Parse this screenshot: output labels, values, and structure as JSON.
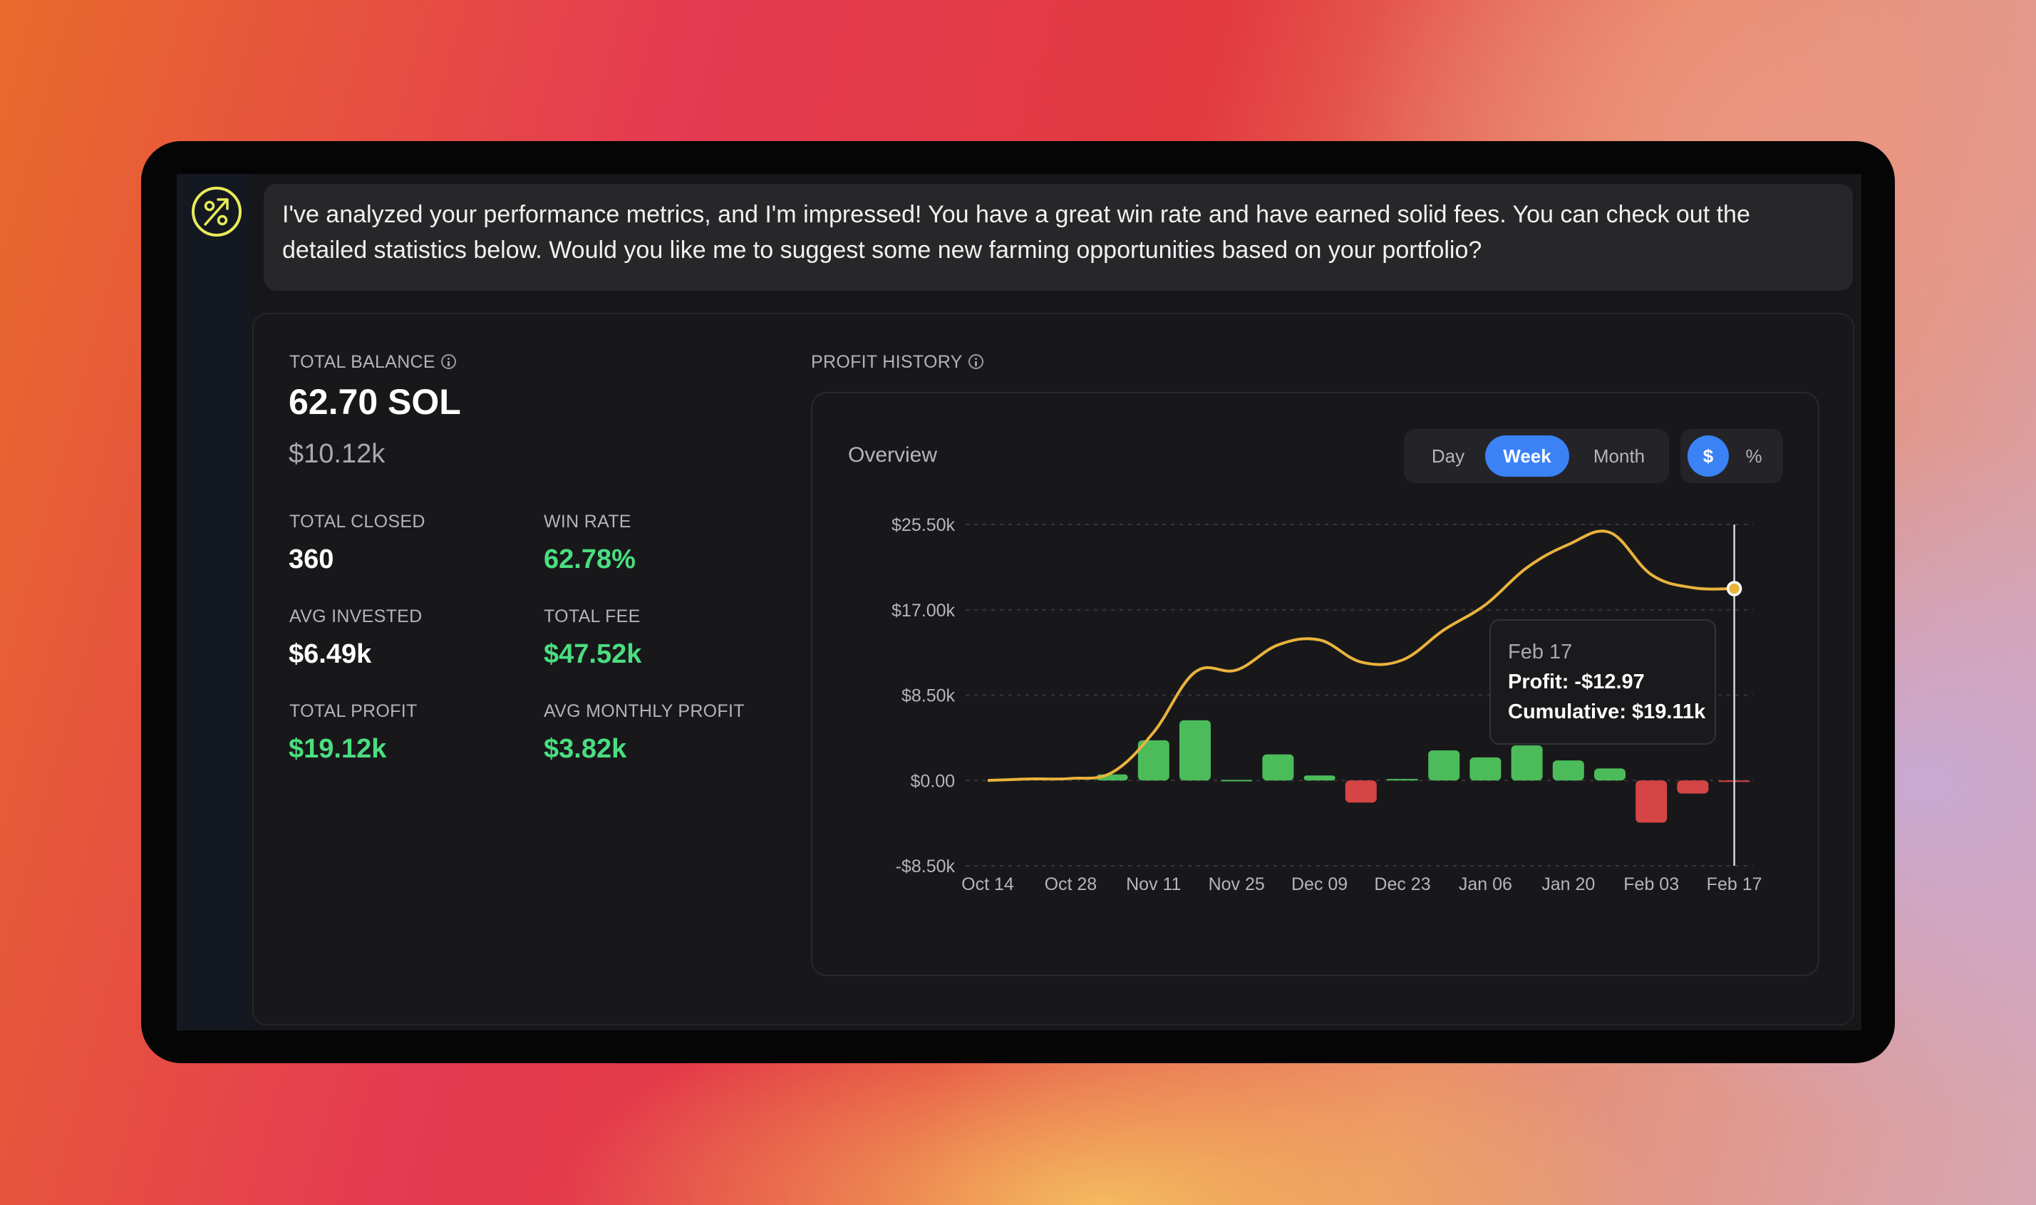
{
  "message": {
    "line1": "I've analyzed your performance metrics, and I'm impressed! You have a great win rate and have earned solid fees. You can check out the",
    "line2": "detailed statistics below. Would you like me to suggest some new farming opportunities based on your portfolio?"
  },
  "stats": {
    "total_balance_label": "TOTAL BALANCE",
    "total_balance_sol": "62.70 SOL",
    "total_balance_usd": "$10.12k",
    "total_closed_label": "TOTAL CLOSED",
    "total_closed": "360",
    "win_rate_label": "WIN RATE",
    "win_rate": "62.78%",
    "avg_invested_label": "AVG INVESTED",
    "avg_invested": "$6.49k",
    "total_fee_label": "TOTAL FEE",
    "total_fee": "$47.52k",
    "total_profit_label": "TOTAL PROFIT",
    "total_profit": "$19.12k",
    "avg_monthly_profit_label": "AVG MONTHLY PROFIT",
    "avg_monthly_profit": "$3.82k"
  },
  "profit_history": {
    "label": "PROFIT HISTORY",
    "overview": "Overview",
    "timeframes": [
      "Day",
      "Week",
      "Month"
    ],
    "selected_timeframe": "Week",
    "units": [
      "$",
      "%"
    ],
    "selected_unit": "$"
  },
  "tooltip": {
    "date": "Feb 17",
    "profit": "Profit: -$12.97",
    "cumulative": "Cumulative: $19.11k"
  },
  "colors": {
    "positive": "#4ade80",
    "negative": "#ef4444",
    "line": "#eab33c",
    "accent": "#3b82f6",
    "bar_positive": "#4cbc5a",
    "bar_negative": "#d64545"
  },
  "chart_data": {
    "type": "bar",
    "y_ticks": [
      25500,
      17000,
      8500,
      0,
      -8500
    ],
    "y_tick_labels": [
      "$25.50k",
      "$17.00k",
      "$8.50k",
      "$0.00",
      "-$8.50k"
    ],
    "ylim": [
      -8500,
      25500
    ],
    "x_tick_labels": [
      "Oct 14",
      "Oct 28",
      "Nov 11",
      "Nov 25",
      "Dec 09",
      "Dec 23",
      "Jan 06",
      "Jan 20",
      "Feb 03",
      "Feb 17"
    ],
    "grid": true,
    "bars": {
      "categories": [
        "Oct 14",
        "Oct 21",
        "Oct 28",
        "Nov 04",
        "Nov 11",
        "Nov 18",
        "Nov 25",
        "Dec 02",
        "Dec 09",
        "Dec 16",
        "Dec 23",
        "Dec 30",
        "Jan 06",
        "Jan 13",
        "Jan 20",
        "Jan 27",
        "Feb 03",
        "Feb 10",
        "Feb 17"
      ],
      "values": [
        0,
        0,
        0,
        600,
        4000,
        6000,
        50,
        2600,
        500,
        -2200,
        150,
        3000,
        2300,
        3500,
        2000,
        1200,
        -4200,
        -1300,
        -13
      ]
    },
    "cumulative": {
      "x": [
        "Oct 14",
        "Oct 21",
        "Oct 28",
        "Nov 04",
        "Nov 11",
        "Nov 18",
        "Nov 25",
        "Dec 02",
        "Dec 09",
        "Dec 16",
        "Dec 23",
        "Dec 30",
        "Jan 06",
        "Jan 13",
        "Jan 20",
        "Jan 27",
        "Feb 03",
        "Feb 10",
        "Feb 17"
      ],
      "values": [
        0,
        150,
        200,
        800,
        4800,
        10800,
        11000,
        13500,
        14000,
        11800,
        12000,
        15000,
        17500,
        21200,
        23500,
        24700,
        20500,
        19200,
        19110
      ]
    }
  }
}
